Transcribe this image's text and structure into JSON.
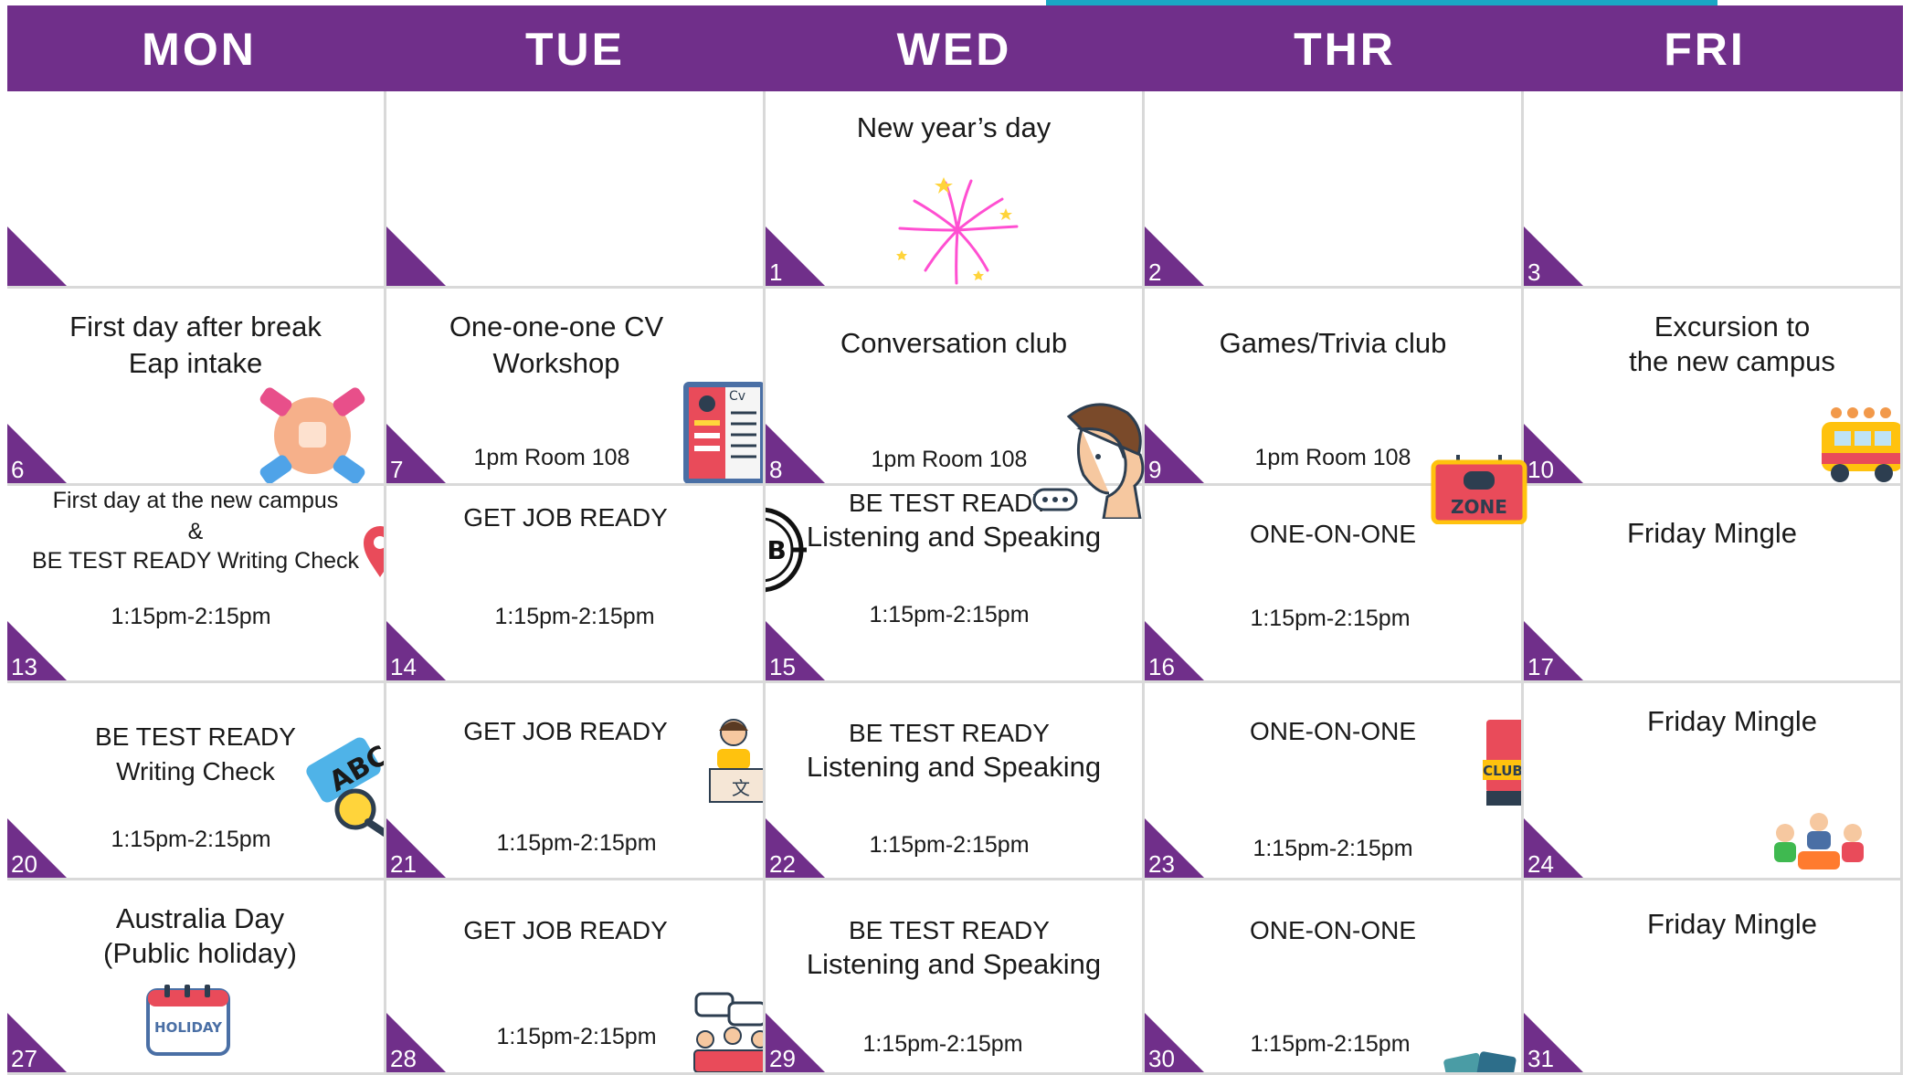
{
  "days": [
    "MON",
    "TUE",
    "WED",
    "THR",
    "FRI"
  ],
  "weeks": [
    [
      {
        "num": ""
      },
      {
        "num": ""
      },
      {
        "num": "1",
        "title": "New year’s day",
        "icon": "fireworks-icon"
      },
      {
        "num": "2"
      },
      {
        "num": "3"
      }
    ],
    [
      {
        "num": "6",
        "line1": "First day after break",
        "line2": "Eap intake",
        "icon": "handshake-icon"
      },
      {
        "num": "7",
        "line1": "One-one-one CV",
        "line2": "Workshop",
        "time": "1pm Room 108",
        "icon": "cv-document-icon"
      },
      {
        "num": "8",
        "title": "Conversation club",
        "time": "1pm Room 108",
        "icon": "talking-person-icon"
      },
      {
        "num": "9",
        "title": "Games/Trivia club",
        "time": "1pm Room 108",
        "icon": "game-zone-icon"
      },
      {
        "num": "10",
        "line1": "Excursion to",
        "line2": "the new campus",
        "icon": "bus-icon"
      }
    ],
    [
      {
        "num": "13",
        "line1": "First day at the new campus",
        "line2": "&",
        "line3": "BE TEST READY Writing Check",
        "time": "1:15pm-2:15pm",
        "icon": "map-pin-route-icon"
      },
      {
        "num": "14",
        "title": "GET JOB READY",
        "time": "1:15pm-2:15pm",
        "icon": "job-target-icon"
      },
      {
        "num": "15",
        "line1": "BE TEST READY",
        "line2": "Listening and Speaking",
        "time": "1:15pm-2:15pm"
      },
      {
        "num": "16",
        "title": "ONE-ON-ONE",
        "time": "1:15pm-2:15pm"
      },
      {
        "num": "17",
        "title": "Friday Mingle"
      }
    ],
    [
      {
        "num": "20",
        "line1": "BE TEST READY",
        "line2": "Writing Check",
        "time": "1:15pm-2:15pm",
        "icon": "abc-magnifier-icon"
      },
      {
        "num": "21",
        "title": "GET JOB READY",
        "time": "1:15pm-2:15pm",
        "icon": "interview-people-icon"
      },
      {
        "num": "22",
        "line1": "BE TEST READY",
        "line2": "Listening and Speaking",
        "time": "1:15pm-2:15pm"
      },
      {
        "num": "23",
        "title": "ONE-ON-ONE",
        "time": "1:15pm-2:15pm",
        "icon": "club-book-icon"
      },
      {
        "num": "24",
        "title": "Friday Mingle",
        "icon": "people-meeting-icon"
      }
    ],
    [
      {
        "num": "27",
        "line1": "Australia Day",
        "line2": "(Public holiday)",
        "icon": "holiday-calendar-icon",
        "icon_text": "HOLIDAY"
      },
      {
        "num": "28",
        "title": "GET JOB READY",
        "time": "1:15pm-2:15pm",
        "icon": "group-chat-icon"
      },
      {
        "num": "29",
        "line1": "BE TEST READY",
        "line2": "Listening and Speaking",
        "time": "1:15pm-2:15pm"
      },
      {
        "num": "30",
        "title": "ONE-ON-ONE",
        "time": "1:15pm-2:15pm",
        "icon": "cards-icon"
      },
      {
        "num": "31",
        "title": "Friday Mingle"
      }
    ]
  ],
  "colors": {
    "header": "#702f8a",
    "accent_cyan": "#1aa7c4",
    "grid": "#d9d9d9"
  }
}
